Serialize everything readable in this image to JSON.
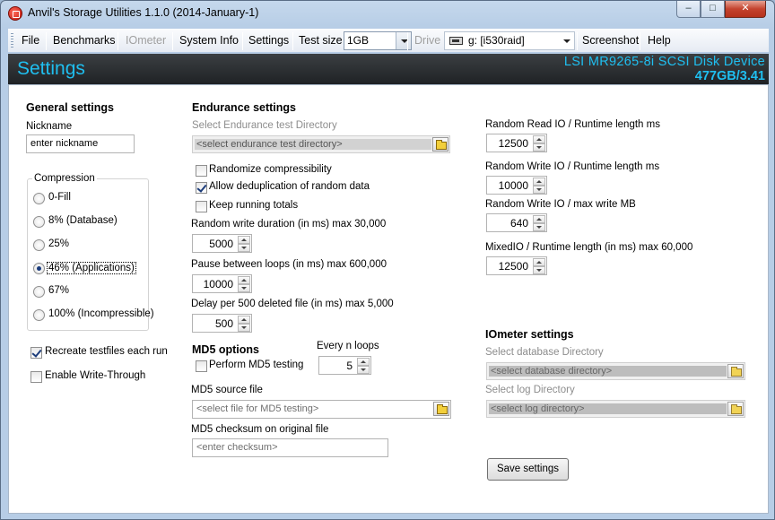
{
  "window": {
    "title": "Anvil's Storage Utilities 1.1.0 (2014-January-1)",
    "min_label": "–",
    "max_label": "□",
    "close_label": "✕"
  },
  "menu": {
    "file": "File",
    "benchmarks": "Benchmarks",
    "iometer": "IOmeter",
    "system_info": "System Info",
    "settings": "Settings",
    "test_size_label": "Test size",
    "test_size_value": "1GB",
    "drive_label": "Drive",
    "drive_value": "g: [i530raid]",
    "screenshot": "Screenshot",
    "help": "Help"
  },
  "banner": {
    "title": "Settings",
    "device": "LSI MR9265-8i SCSI Disk Device",
    "size": "477GB/3.41"
  },
  "general": {
    "heading": "General settings",
    "nickname_label": "Nickname",
    "nickname_value": "enter nickname",
    "compression_label": "Compression",
    "compression_options": [
      "0-Fill",
      "8% (Database)",
      "25%",
      "46% (Applications)",
      "67%",
      "100% (Incompressible)"
    ],
    "compression_selected": 3,
    "recreate_label": "Recreate testfiles each run",
    "recreate_checked": true,
    "write_through_label": "Enable Write-Through",
    "write_through_checked": false
  },
  "endurance": {
    "heading": "Endurance settings",
    "dir_label": "Select Endurance test Directory",
    "dir_placeholder": "<select endurance test directory>",
    "randomize_label": "Randomize compressibility",
    "randomize_checked": false,
    "dedup_label": "Allow deduplication of random data",
    "dedup_checked": true,
    "keep_totals_label": "Keep running totals",
    "keep_totals_checked": false,
    "random_write_label": "Random write duration (in ms) max 30,000",
    "random_write_value": "5000",
    "pause_label": "Pause between loops (in ms) max 600,000",
    "pause_value": "10000",
    "delay_label": "Delay per 500 deleted file (in ms) max 5,000",
    "delay_value": "500"
  },
  "md5": {
    "heading": "MD5 options",
    "every_label": "Every n loops",
    "every_value": "5",
    "perform_label": "Perform MD5 testing",
    "perform_checked": false,
    "source_label": "MD5 source file",
    "source_placeholder": "<select file for MD5 testing>",
    "checksum_label": "MD5 checksum on original file",
    "checksum_placeholder": "<enter checksum>"
  },
  "runtime": {
    "read_label": "Random Read IO / Runtime length ms",
    "read_value": "12500",
    "write_label": "Random Write IO / Runtime length ms",
    "write_value": "10000",
    "write_mb_label": "Random Write IO / max write MB",
    "write_mb_value": "640",
    "mixed_label": "MixedIO / Runtime length (in ms) max 60,000",
    "mixed_value": "12500"
  },
  "iometer": {
    "heading": "IOmeter settings",
    "db_label": "Select database Directory",
    "db_placeholder": "<select database directory>",
    "log_label": "Select log Directory",
    "log_placeholder": "<select log directory>"
  },
  "save_label": "Save settings"
}
